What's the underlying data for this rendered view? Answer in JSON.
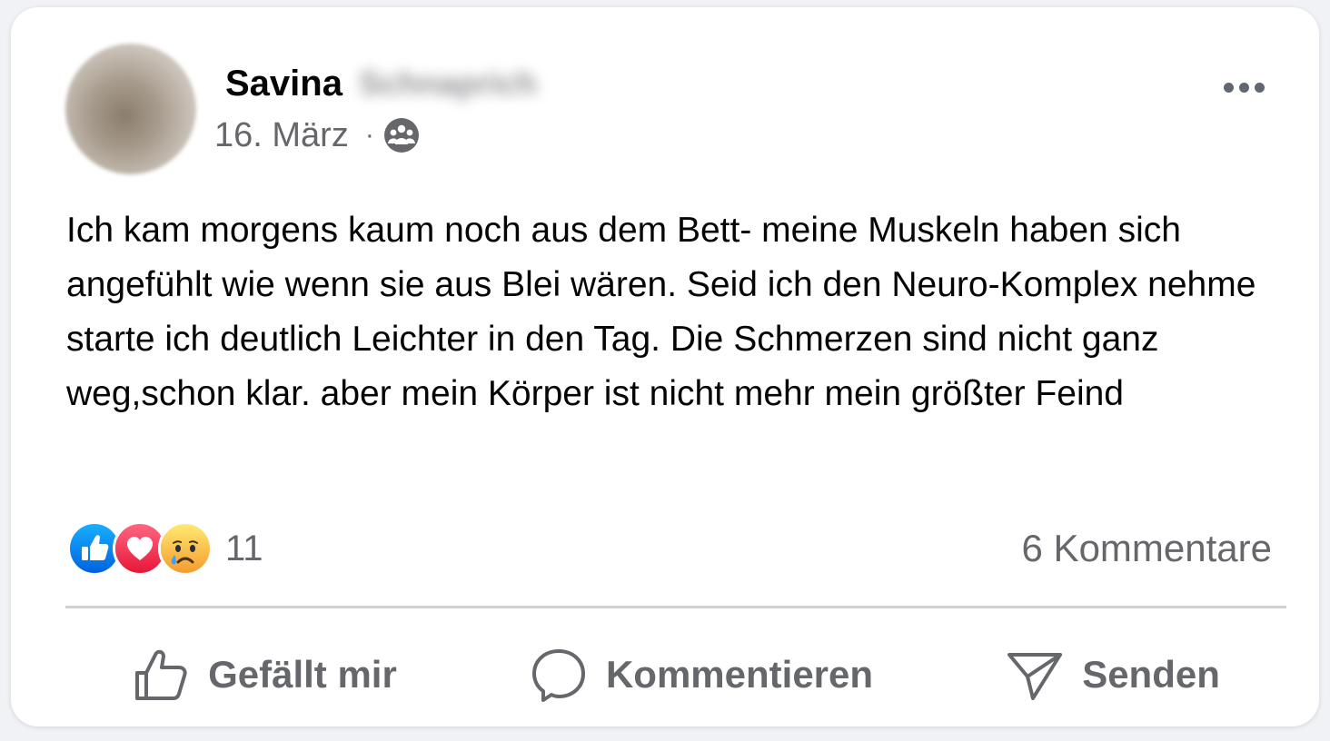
{
  "post": {
    "author_first_name": "Savina",
    "author_last_name_blurred": "Schnaprich",
    "date": "16. März",
    "separator": "·",
    "audience_icon": "group-icon",
    "text": "Ich kam morgens kaum noch aus dem Bett- meine Muskeln haben sich angefühlt wie wenn sie aus Blei wären. Seid ich den Neuro-Komplex nehme starte ich deutlich Leichter in den Tag. Die Schmerzen sind nicht ganz weg,schon klar. aber mein Körper ist nicht mehr mein größter Feind"
  },
  "engagement": {
    "reaction_icons": [
      "like-icon",
      "love-icon",
      "sad-icon"
    ],
    "reaction_count": "11",
    "comments_label": "6 Kommentare"
  },
  "actions": {
    "like_label": "Gefällt mir",
    "comment_label": "Kommentieren",
    "share_label": "Senden"
  },
  "colors": {
    "like_blue": "#1877f2",
    "love_red": "#f33e58",
    "sad_yellow": "#f7b125",
    "secondary_text": "#65676b"
  }
}
